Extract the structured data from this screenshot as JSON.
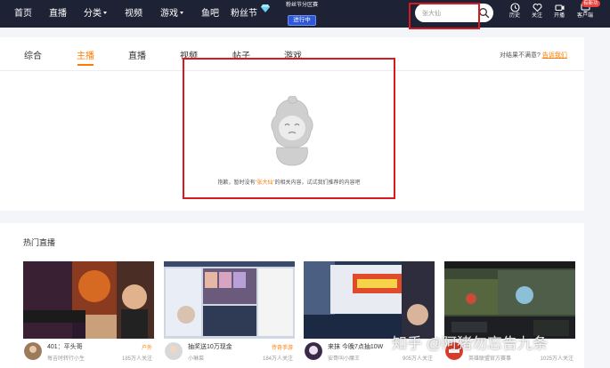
{
  "nav": {
    "home": "首页",
    "live": "直播",
    "category": "分类",
    "video": "视频",
    "game": "游戏",
    "yuba": "鱼吧",
    "fans": "粉丝节",
    "fan_event": {
      "title": "粉丝节分区赛",
      "status": "进行中"
    }
  },
  "search": {
    "value": "张大仙"
  },
  "toolbar": {
    "history": "历史",
    "follow": "关注",
    "broadcast": "开播",
    "client": "客户端",
    "new_badge": "有新功"
  },
  "tabs": [
    "综合",
    "主播",
    "直播",
    "视频",
    "帖子",
    "游戏"
  ],
  "active_tab": "主播",
  "feedback": {
    "text": "对结果不满意?",
    "link": "告诉我们"
  },
  "empty": {
    "prefix": "抱歉，暂时没有",
    "keyword": "“张大仙”",
    "suffix": "的相关内容，试试我们推荐的内容吧"
  },
  "hot": {
    "title": "热门直播",
    "cards": [
      {
        "title": "401：平头哥",
        "tag": "户外",
        "anchor": "每吉时转行小生",
        "count": "185万人关注"
      },
      {
        "title": "抽奖送10万现金",
        "tag": "传奇手游",
        "anchor": "小琳菜",
        "count": "184万人关注"
      },
      {
        "title": "来抹  今晚7点抽10W",
        "tag": "",
        "anchor": "安哥叫小魔王",
        "count": "905万人关注"
      },
      {
        "title": "",
        "tag": "",
        "anchor": "英雄联盟官方赛事",
        "count": "1025万人关注"
      }
    ]
  },
  "watermark": "知乎 @阿猪勿忘告九条",
  "colors": {
    "accent": "#ff7b00",
    "nav_bg": "#1e2235",
    "highlight_frame": "#d8191f"
  }
}
